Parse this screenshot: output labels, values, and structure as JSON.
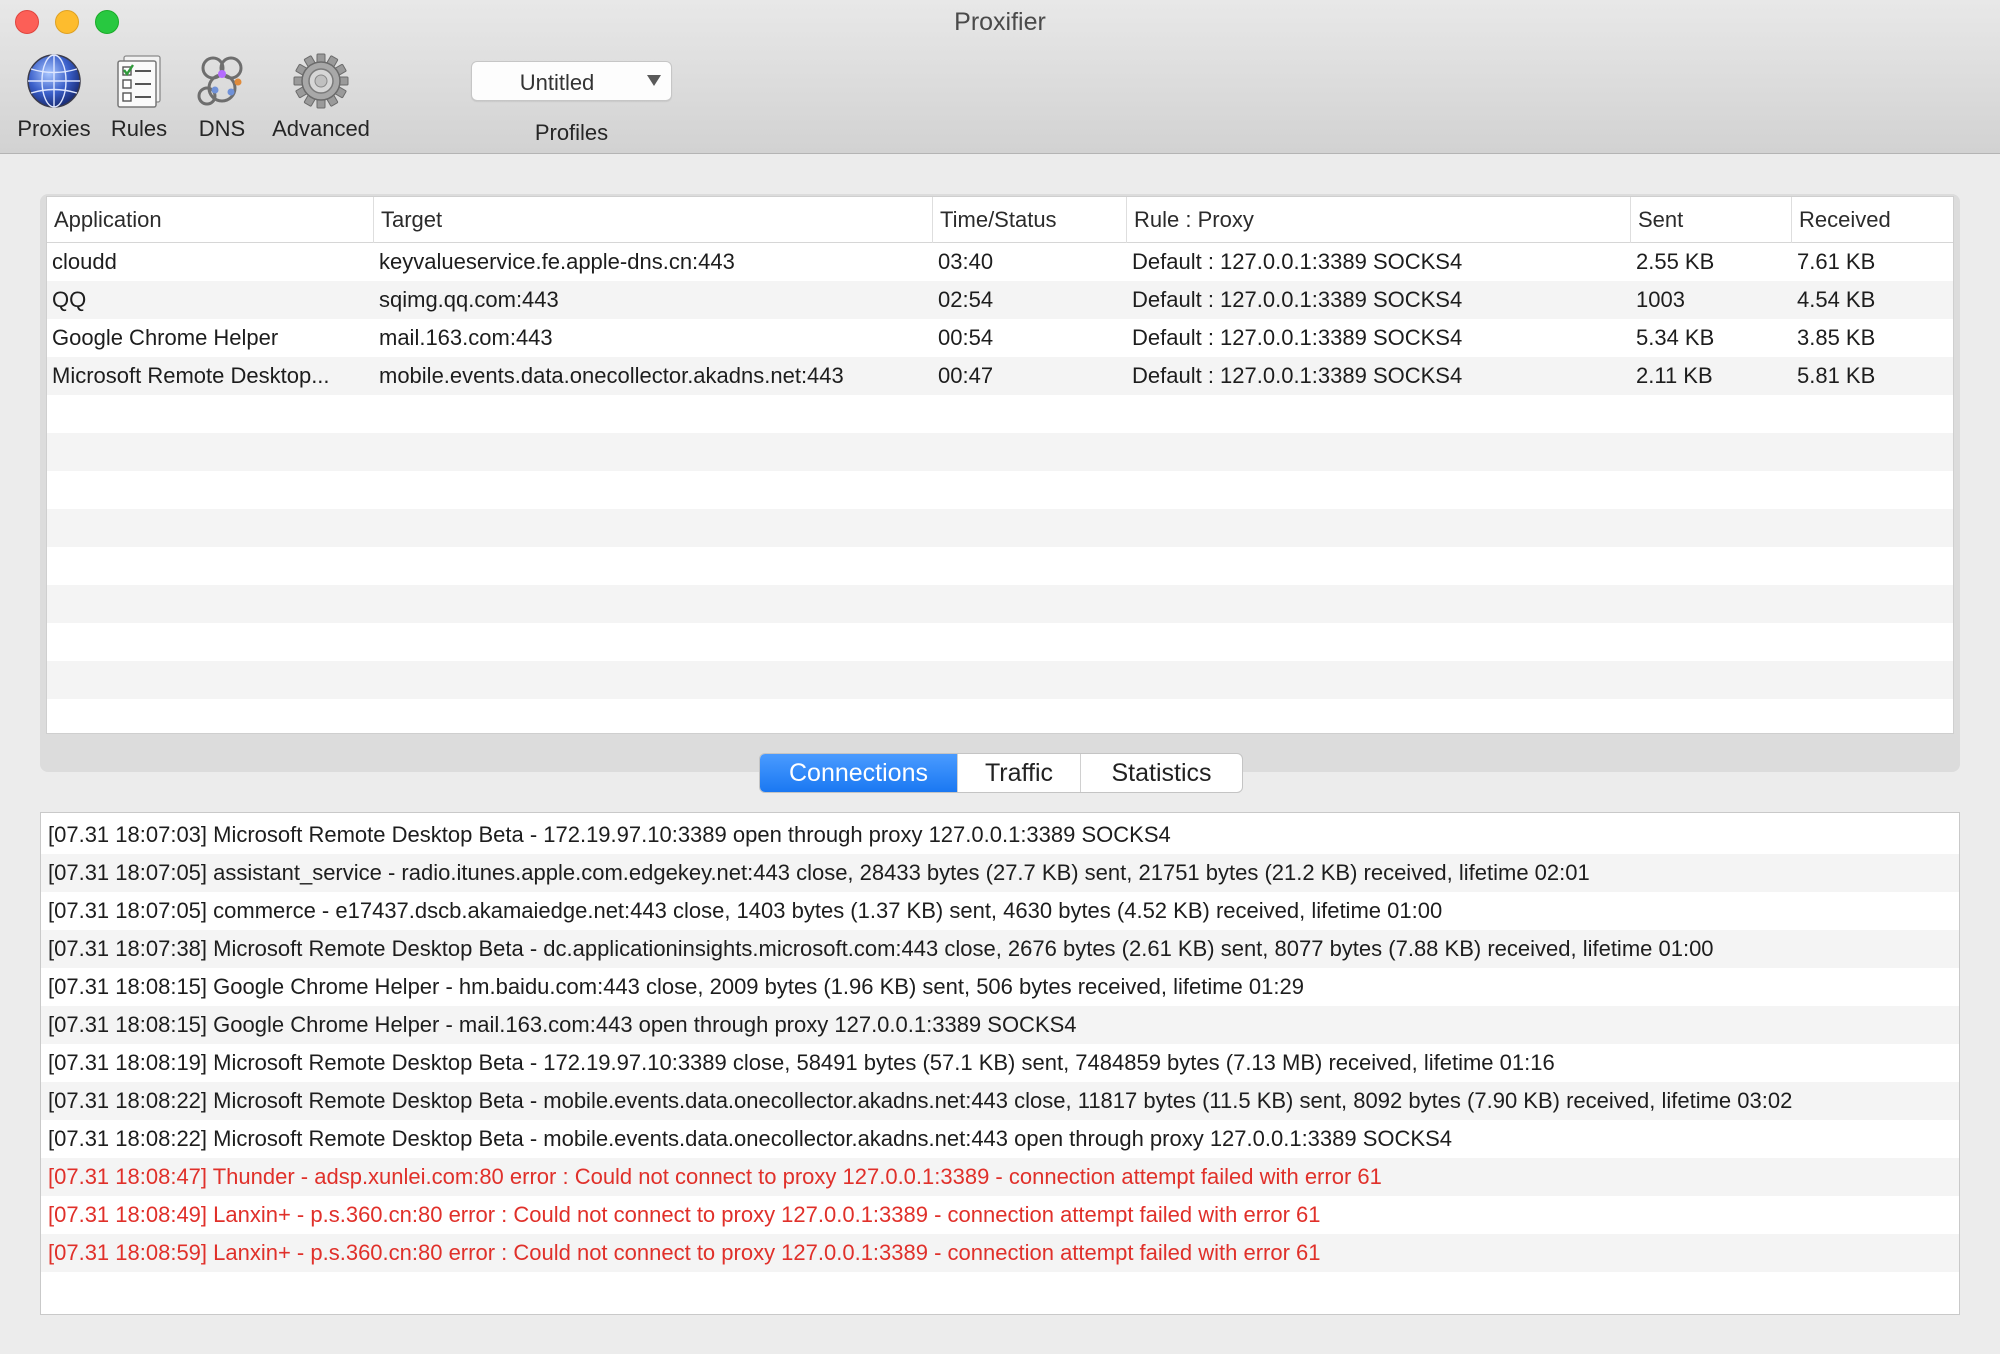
{
  "window": {
    "title": "Proxifier"
  },
  "toolbar": {
    "items": [
      {
        "label": "Proxies",
        "icon": "globe-icon"
      },
      {
        "label": "Rules",
        "icon": "rules-list-icon"
      },
      {
        "label": "DNS",
        "icon": "dns-network-icon"
      },
      {
        "label": "Advanced",
        "icon": "gear-icon"
      }
    ],
    "profile": {
      "value": "Untitled",
      "label": "Profiles"
    }
  },
  "connections_table": {
    "columns": [
      "Application",
      "Target",
      "Time/Status",
      "Rule : Proxy",
      "Sent",
      "Received"
    ],
    "rows": [
      [
        "cloudd",
        "keyvalueservice.fe.apple-dns.cn:443",
        "03:40",
        "Default : 127.0.0.1:3389 SOCKS4",
        "2.55 KB",
        "7.61 KB"
      ],
      [
        "QQ",
        "sqimg.qq.com:443",
        "02:54",
        "Default : 127.0.0.1:3389 SOCKS4",
        "1003",
        "4.54 KB"
      ],
      [
        "Google Chrome Helper",
        "mail.163.com:443",
        "00:54",
        "Default : 127.0.0.1:3389 SOCKS4",
        "5.34 KB",
        "3.85 KB"
      ],
      [
        "Microsoft Remote Desktop...",
        "mobile.events.data.onecollector.akadns.net:443",
        "00:47",
        "Default : 127.0.0.1:3389 SOCKS4",
        "2.11 KB",
        "5.81 KB"
      ]
    ]
  },
  "tabs": {
    "items": [
      "Connections",
      "Traffic",
      "Statistics"
    ],
    "active": "Connections"
  },
  "log": {
    "lines": [
      {
        "text": "[07.31 18:07:03] Microsoft Remote Desktop Beta - 172.19.97.10:3389 open through proxy 127.0.0.1:3389 SOCKS4",
        "level": "info"
      },
      {
        "text": "[07.31 18:07:05] assistant_service - radio.itunes.apple.com.edgekey.net:443 close, 28433 bytes (27.7 KB) sent, 21751 bytes (21.2 KB) received, lifetime 02:01",
        "level": "info"
      },
      {
        "text": "[07.31 18:07:05] commerce - e17437.dscb.akamaiedge.net:443 close, 1403 bytes (1.37 KB) sent, 4630 bytes (4.52 KB) received, lifetime 01:00",
        "level": "info"
      },
      {
        "text": "[07.31 18:07:38] Microsoft Remote Desktop Beta - dc.applicationinsights.microsoft.com:443 close, 2676 bytes (2.61 KB) sent, 8077 bytes (7.88 KB) received, lifetime 01:00",
        "level": "info"
      },
      {
        "text": "[07.31 18:08:15] Google Chrome Helper - hm.baidu.com:443 close, 2009 bytes (1.96 KB) sent, 506 bytes received, lifetime 01:29",
        "level": "info"
      },
      {
        "text": "[07.31 18:08:15] Google Chrome Helper - mail.163.com:443 open through proxy 127.0.0.1:3389 SOCKS4",
        "level": "info"
      },
      {
        "text": "[07.31 18:08:19] Microsoft Remote Desktop Beta - 172.19.97.10:3389 close, 58491 bytes (57.1 KB) sent, 7484859 bytes (7.13 MB) received, lifetime 01:16",
        "level": "info"
      },
      {
        "text": "[07.31 18:08:22] Microsoft Remote Desktop Beta - mobile.events.data.onecollector.akadns.net:443 close, 11817 bytes (11.5 KB) sent, 8092 bytes (7.90 KB) received, lifetime 03:02",
        "level": "info"
      },
      {
        "text": "[07.31 18:08:22] Microsoft Remote Desktop Beta - mobile.events.data.onecollector.akadns.net:443 open through proxy 127.0.0.1:3389 SOCKS4",
        "level": "info"
      },
      {
        "text": "[07.31 18:08:47] Thunder - adsp.xunlei.com:80 error : Could not connect to proxy 127.0.0.1:3389 - connection attempt failed with error 61",
        "level": "error"
      },
      {
        "text": "[07.31 18:08:49] Lanxin+ - p.s.360.cn:80 error : Could not connect to proxy 127.0.0.1:3389 - connection attempt failed with error 61",
        "level": "error"
      },
      {
        "text": "[07.31 18:08:59] Lanxin+ - p.s.360.cn:80 error : Could not connect to proxy 127.0.0.1:3389 - connection attempt failed with error 61",
        "level": "error"
      }
    ]
  },
  "colors": {
    "accent": "#1a78f2",
    "error": "#e0302a"
  }
}
